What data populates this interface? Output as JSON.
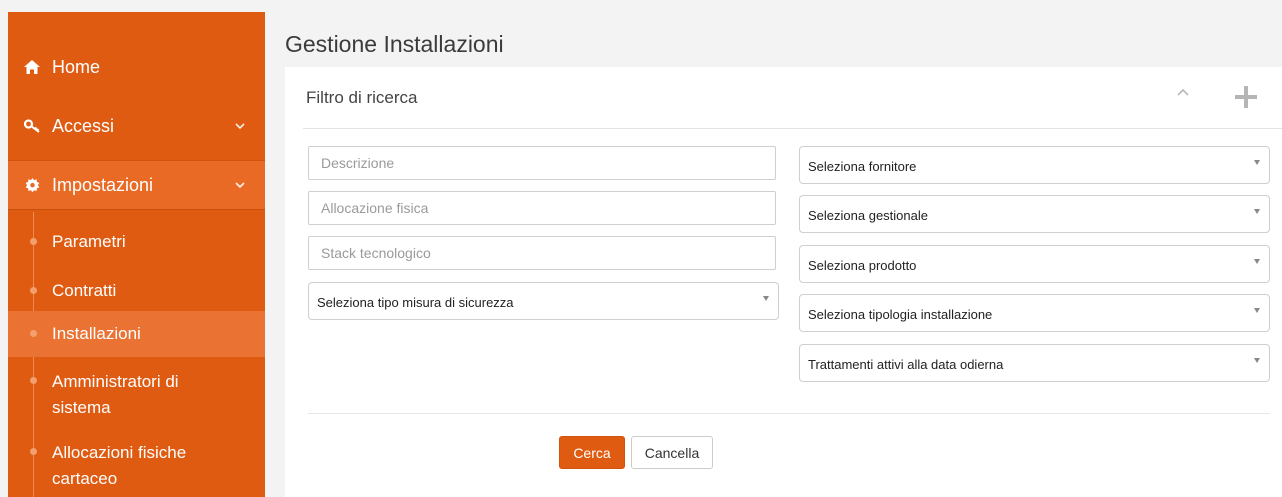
{
  "sidebar": {
    "items": [
      {
        "label": "Home",
        "icon": "home-icon"
      },
      {
        "label": "Accessi",
        "icon": "key-icon"
      },
      {
        "label": "Impostazioni",
        "icon": "gear-icon"
      }
    ],
    "submenu": [
      {
        "label": "Parametri"
      },
      {
        "label": "Contratti"
      },
      {
        "label": "Installazioni",
        "active": true
      },
      {
        "label": "Amministratori di sistema"
      },
      {
        "label": "Allocazioni fisiche cartaceo"
      }
    ]
  },
  "main": {
    "page_title": "Gestione Installazioni",
    "panel": {
      "title": "Filtro di ricerca",
      "inputs": [
        {
          "placeholder": "Descrizione",
          "value": ""
        },
        {
          "placeholder": "Allocazione fisica",
          "value": ""
        },
        {
          "placeholder": "Stack tecnologico",
          "value": ""
        }
      ],
      "left_select": "Seleziona tipo misura di sicurezza",
      "right_selects": [
        "Seleziona fornitore",
        "Seleziona gestionale",
        "Seleziona prodotto",
        "Seleziona tipologia installazione",
        "Trattamenti attivi alla data odierna"
      ],
      "search_button": "Cerca",
      "cancel_button": "Cancella"
    }
  },
  "colors": {
    "brand": "#e05b12",
    "sidebar_active": "#ea7232",
    "background": "#f3f3f4"
  }
}
